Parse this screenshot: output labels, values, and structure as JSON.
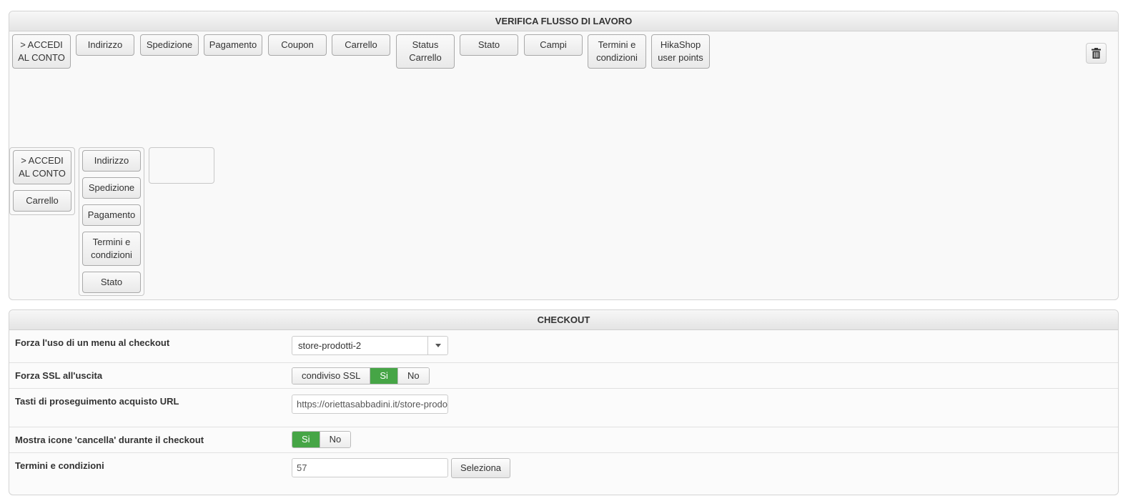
{
  "workflow": {
    "title": "VERIFICA FLUSSO DI LAVORO",
    "available_steps": [
      "> ACCEDI AL CONTO",
      "Indirizzo",
      "Spedizione",
      "Pagamento",
      "Coupon",
      "Carrello",
      "Status Carrello",
      "Stato",
      "Campi",
      "Termini e condizioni",
      "HikaShop user points"
    ],
    "trash_icon": "trash-icon",
    "groups": [
      {
        "steps": [
          "> ACCEDI AL CONTO",
          "Carrello"
        ]
      },
      {
        "steps": [
          "Indirizzo",
          "Spedizione",
          "Pagamento",
          "Termini e condizioni",
          "Stato"
        ]
      },
      {
        "steps": []
      }
    ]
  },
  "checkout": {
    "title": "CHECKOUT",
    "menu": {
      "label": "Forza l'uso di un menu al checkout",
      "value": "store-prodotti-2"
    },
    "ssl": {
      "label": "Forza SSL all'uscita",
      "options": [
        "condiviso SSL",
        "Si",
        "No"
      ],
      "selected": "Si"
    },
    "continue_url": {
      "label": "Tasti di proseguimento acquisto URL",
      "value": "https://oriettasabbadini.it/store-prodotti"
    },
    "delete_icons": {
      "label": "Mostra icone 'cancella' durante il checkout",
      "options": [
        "Si",
        "No"
      ],
      "selected": "Si"
    },
    "terms": {
      "label": "Termini e condizioni",
      "value": "57",
      "button": "Seleziona"
    }
  },
  "colors": {
    "active_toggle": "#46a546",
    "panel_border": "#d4d4d4"
  }
}
